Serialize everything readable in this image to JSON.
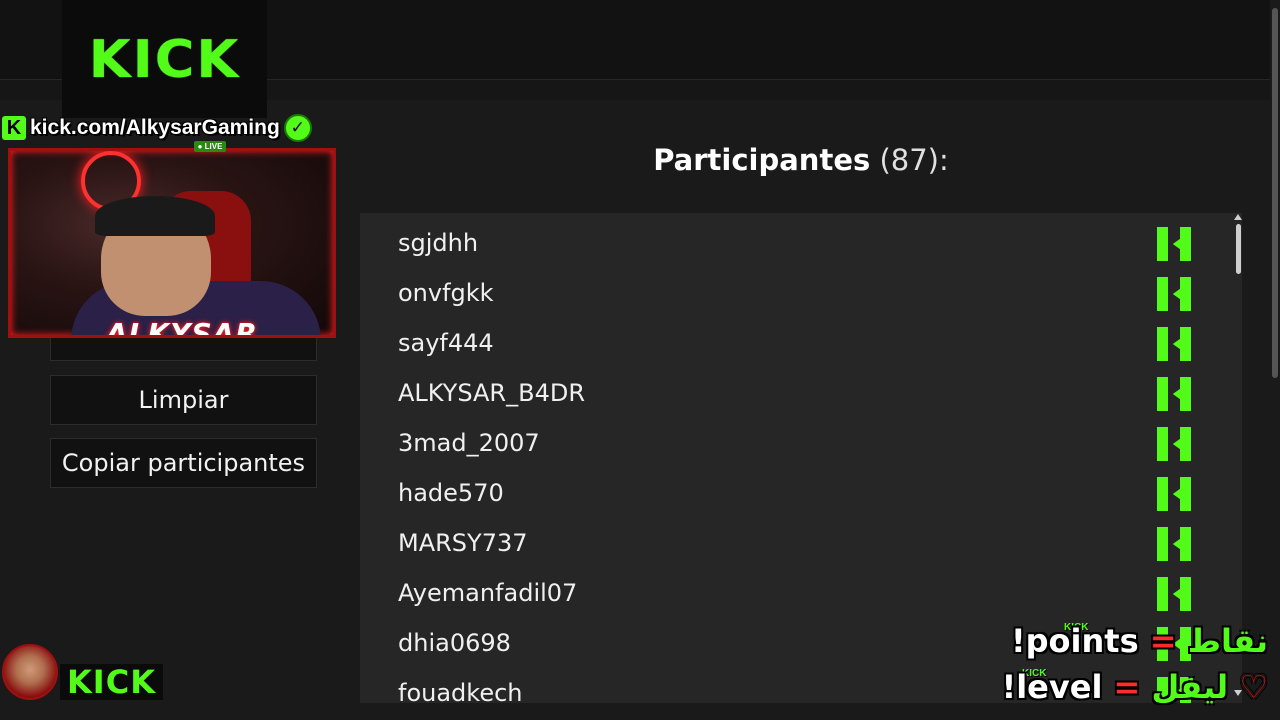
{
  "stream_overlay": {
    "logo": "KICK",
    "url_text": "kick.com/AlkysarGaming",
    "live_badge": "● LIVE",
    "cam_name": "ALKYSAR",
    "bottom_logo": "KICK",
    "commands": {
      "line1_arabic": "نقاط",
      "line1_eq": "=",
      "line1_cmd": "!points",
      "line1_small": "KICK",
      "line2_arabic": "ليفل",
      "line2_eq": "=",
      "line2_cmd": "!level",
      "line2_small": "KICK",
      "heart": "♡"
    }
  },
  "sidebar": {
    "clear_button": "Limpiar",
    "copy_button": "Copiar participantes"
  },
  "main": {
    "title_label": "Participantes",
    "title_count": "(87):"
  },
  "participants": [
    "sgjdhh",
    "onvfgkk",
    "sayf444",
    "ALKYSAR_B4DR",
    "3mad_2007",
    "hade570",
    "MARSY737",
    "Ayemanfadil07",
    "dhia0698",
    "fouadkech"
  ],
  "colors": {
    "kick_green": "#53fc18",
    "panel_bg": "#262626",
    "page_bg": "#1a1a1a"
  }
}
